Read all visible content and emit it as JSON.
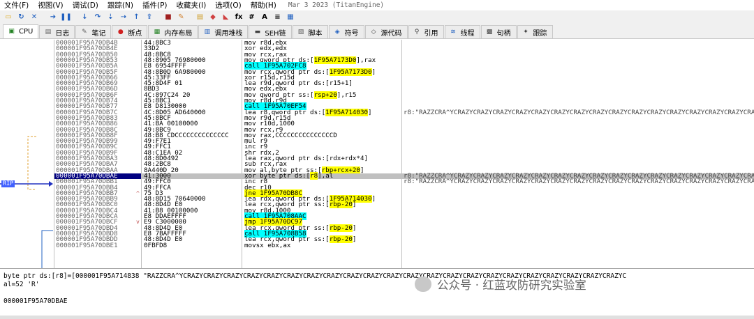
{
  "menu": [
    "文件(F)",
    "视图(V)",
    "调试(D)",
    "跟踪(N)",
    "插件(P)",
    "收藏夹(I)",
    "选项(O)",
    "帮助(H)"
  ],
  "title": "Mar 3 2023 (TitanEngine)",
  "toolbar_icons": [
    "open-icon",
    "restart-icon",
    "close-icon",
    "run-icon",
    "pause-icon",
    "step-into-icon",
    "step-over-icon",
    "trace-into-icon",
    "trace-over-icon",
    "execute-till-return-icon",
    "run-to-user-code-icon",
    "scylla-icon",
    "patch-icon",
    "comment-icon",
    "label-icon",
    "bookmark-icon",
    "function-icon",
    "hash-icon",
    "font-icon",
    "strings-icon",
    "calc-icon"
  ],
  "tabs": [
    {
      "label": "CPU",
      "icon": "cpu-icon"
    },
    {
      "label": "日志",
      "icon": "log-icon"
    },
    {
      "label": "笔记",
      "icon": "notes-icon"
    },
    {
      "label": "断点",
      "icon": "breakpoint-icon"
    },
    {
      "label": "内存布局",
      "icon": "memory-icon"
    },
    {
      "label": "调用堆栈",
      "icon": "callstack-icon"
    },
    {
      "label": "SEH链",
      "icon": "seh-icon"
    },
    {
      "label": "脚本",
      "icon": "script-icon"
    },
    {
      "label": "符号",
      "icon": "symbol-icon"
    },
    {
      "label": "源代码",
      "icon": "source-icon"
    },
    {
      "label": "引用",
      "icon": "reference-icon"
    },
    {
      "label": "线程",
      "icon": "thread-icon"
    },
    {
      "label": "句柄",
      "icon": "handle-icon"
    },
    {
      "label": "跟踪",
      "icon": "trace-icon"
    }
  ],
  "rip_label": "RIP",
  "rows": [
    {
      "addr": "000001F95A70DB4B",
      "bytes": "44:8BC3",
      "asm": "mov r8d,ebx"
    },
    {
      "addr": "000001F95A70DB4E",
      "bytes": "33D2",
      "asm": "xor edx,edx"
    },
    {
      "addr": "000001F95A70DB50",
      "bytes": "48:8BC8",
      "asm": "mov rcx,rax"
    },
    {
      "addr": "000001F95A70DB53",
      "bytes": "48:8905 76980000",
      "asm": "mov qword ptr ds:[",
      "hl": "1F95A7173D0",
      "asm2": "],rax",
      "hlc": "yel"
    },
    {
      "addr": "000001F95A70DB5A",
      "bytes": "E8 6954FFFF",
      "asm": "",
      "hl": "call 1F95A702FC8",
      "hlc": "cyan"
    },
    {
      "addr": "000001F95A70DB5F",
      "bytes": "48:8B0D 6A980000",
      "asm": "mov rcx,qword ptr ds:[",
      "hl": "1F95A7173D0",
      "asm2": "]",
      "hlc": "yel"
    },
    {
      "addr": "000001F95A70DB66",
      "bytes": "45:33FF",
      "asm": "xor r15d,r15d"
    },
    {
      "addr": "000001F95A70DB69",
      "bytes": "45:8D4F 01",
      "asm": "lea r9d,qword ptr ds:[r15+1]"
    },
    {
      "addr": "000001F95A70DB6D",
      "bytes": "8BD3",
      "asm": "mov edx,ebx"
    },
    {
      "addr": "000001F95A70DB6F",
      "bytes": "4C:897C24 20",
      "asm": "mov qword ptr ss:[",
      "hl": "rsp+20",
      "asm2": "],r15",
      "hlc": "yel"
    },
    {
      "addr": "000001F95A70DB74",
      "bytes": "45:8BC1",
      "asm": "mov r8d,r9d"
    },
    {
      "addr": "000001F95A70DB77",
      "bytes": "E8 D8130000",
      "asm": "",
      "hl": "call 1F95A70EF54",
      "hlc": "cyan"
    },
    {
      "addr": "000001F95A70DB7C",
      "bytes": "4C:8D05 AD640000",
      "asm": "lea r8,qword ptr ds:[",
      "hl": "1F95A714030",
      "asm2": "]",
      "hlc": "yel",
      "cm": "r8:\"RAZZCRA^YCRAZYCRAZYCRAZYCRAZYCRAZYCRAZYCRAZYCRAZYCRAZYCRAZYCRAZYCRAZYCRAZYCRAZYCRAZYCRAZYC"
    },
    {
      "addr": "000001F95A70DB83",
      "bytes": "45:8BCF",
      "asm": "mov r9d,r15d"
    },
    {
      "addr": "000001F95A70DB86",
      "bytes": "41:BA 00100000",
      "asm": "mov r10d,1000"
    },
    {
      "addr": "000001F95A70DB8C",
      "bytes": "49:8BC9",
      "asm": "mov rcx,r9"
    },
    {
      "addr": "000001F95A70DB8F",
      "bytes": "48:B8 CDCCCCCCCCCCCCCC",
      "asm": "mov rax,CCCCCCCCCCCCCCCD"
    },
    {
      "addr": "000001F95A70DB99",
      "bytes": "49:F7E1",
      "asm": "mul r9"
    },
    {
      "addr": "000001F95A70DB9C",
      "bytes": "49:FFC1",
      "asm": "inc r9"
    },
    {
      "addr": "000001F95A70DB9F",
      "bytes": "48:C1EA 02",
      "asm": "shr rdx,2"
    },
    {
      "addr": "000001F95A70DBA3",
      "bytes": "48:8D0492",
      "asm": "lea rax,qword ptr ds:[rdx+rdx*4]"
    },
    {
      "addr": "000001F95A70DBA7",
      "bytes": "48:2BC8",
      "asm": "sub rcx,rax"
    },
    {
      "addr": "000001F95A70DBAA",
      "bytes": "8A440D 20",
      "asm": "mov al,byte ptr ss:[",
      "hl": "rbp+rcx+20",
      "asm2": "]",
      "hlc": "yel"
    },
    {
      "addr": "000001F95A70DBAE",
      "bytes": "41:3000",
      "asm": "xor byte ptr ds:[",
      "hl": "r8",
      "asm2": "],al",
      "hlc": "yel",
      "sel": true,
      "cm": "r8:\"RAZZCRA^YCRAZYCRAZYCRAZYCRAZYCRAZYCRAZYCRAZYCRAZYCRAZYCRAZYCRAZYCRAZYCRAZYCRAZYCRAZYCRAZYC"
    },
    {
      "addr": "000001F95A70DBB1",
      "bytes": "49:FFC0",
      "asm": "inc r8",
      "cm": "r8:\"RAZZCRA^YCRAZYCRAZYCRAZYCRAZYCRAZYCRAZYCRAZYCRAZYCRAZYCRAZYCRAZYCRAZYCRAZYCRAZYCRAZYCRAZYC"
    },
    {
      "addr": "000001F95A70DBB4",
      "bytes": "49:FFCA",
      "asm": "dec r10"
    },
    {
      "addr": "000001F95A70DBB7",
      "bytes": "75 D3",
      "asm": "",
      "hl": "jne 1F95A70DB8C",
      "hlc": "yel",
      "mark": "^"
    },
    {
      "addr": "000001F95A70DBB9",
      "bytes": "48:8D15 70640000",
      "asm": "lea rdx,qword ptr ds:[",
      "hl": "1F95A714030",
      "asm2": "]",
      "hlc": "yel"
    },
    {
      "addr": "000001F95A70DBC0",
      "bytes": "48:8D4D E0",
      "asm": "lea rcx,qword ptr ss:[",
      "hl": "rbp-20",
      "asm2": "]",
      "hlc": "yel"
    },
    {
      "addr": "000001F95A70DBC4",
      "bytes": "41:B8 00100000",
      "asm": "mov r8d,1000"
    },
    {
      "addr": "000001F95A70DBCA",
      "bytes": "E8 DDAEFFFF",
      "asm": "",
      "hl": "call 1F95A708AAC",
      "hlc": "cyan"
    },
    {
      "addr": "000001F95A70DBCF",
      "bytes": "E9 C3000000",
      "asm": "",
      "hl": "jmp 1F95A70DC97",
      "hlc": "yel",
      "mark": "v"
    },
    {
      "addr": "000001F95A70DBD4",
      "bytes": "48:8D4D E0",
      "asm": "lea rcx,qword ptr ss:[",
      "hl": "rbp-20",
      "asm2": "]",
      "hlc": "yel"
    },
    {
      "addr": "000001F95A70DBD8",
      "bytes": "E8 7BAFFFFF",
      "asm": "",
      "hl": "call 1F95A708B58",
      "hlc": "cyan"
    },
    {
      "addr": "000001F95A70DBDD",
      "bytes": "48:8D4D E0",
      "asm": "lea rcx,qword ptr ss:[",
      "hl": "rbp-20",
      "asm2": "]",
      "hlc": "yel"
    },
    {
      "addr": "000001F95A70DBE1",
      "bytes": "0FBFD8",
      "asm": "movsx ebx,ax"
    }
  ],
  "info": {
    "line1": "byte ptr ds:[r8]=[000001F95A714838 \"RAZZCRA^YCRAZYCRAZYCRAZYCRAZYCRAZYCRAZYCRAZYCRAZYCRAZYCRAZYCRAZYCRAZYCRAZYCRAZYCRAZYCRAZYCRAZYCRAZYCRAZYCRAZYCRAZYCRAZYC",
    "line2": "al=52 'R'",
    "line3": "000001F95A70DBAE"
  },
  "watermark": "公众号 · 红蓝攻防研究实验室",
  "colors": {
    "selected_row": "#c0c0c0",
    "call_highlight": "#00ffff",
    "jump_highlight": "#ffff00",
    "rip_label": "#4060ff"
  }
}
